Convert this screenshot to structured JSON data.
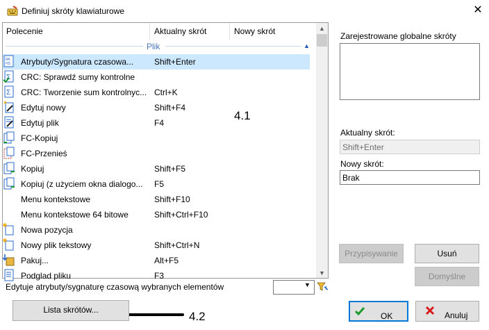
{
  "window": {
    "title": "Definiuj skróty klawiaturowe",
    "close_glyph": "✕"
  },
  "list": {
    "columns": [
      "Polecenie",
      "Aktualny skrót",
      "Nowy skrót"
    ],
    "group": "Plik",
    "rows": [
      {
        "name": "Atrybuty/Sygnatura czasowa...",
        "shortcut": "Shift+Enter",
        "icon": "attributes-icon",
        "selected": true
      },
      {
        "name": "CRC: Sprawdź sumy kontrolne",
        "shortcut": "",
        "icon": "checksum-verify-icon"
      },
      {
        "name": "CRC: Tworzenie sum kontrolnyc...",
        "shortcut": "Ctrl+K",
        "icon": "checksum-create-icon"
      },
      {
        "name": "Edytuj nowy",
        "shortcut": "Shift+F4",
        "icon": "edit-new-icon"
      },
      {
        "name": "Edytuj plik",
        "shortcut": "F4",
        "icon": "edit-file-icon"
      },
      {
        "name": "FC-Kopiuj",
        "shortcut": "",
        "icon": "fc-copy-icon"
      },
      {
        "name": "FC-Przenieś",
        "shortcut": "",
        "icon": "fc-move-icon"
      },
      {
        "name": "Kopiuj",
        "shortcut": "Shift+F5",
        "icon": "copy-icon"
      },
      {
        "name": "Kopiuj (z użyciem okna dialogo...",
        "shortcut": "F5",
        "icon": "copy-dialog-icon"
      },
      {
        "name": "Menu kontekstowe",
        "shortcut": "Shift+F10",
        "icon": ""
      },
      {
        "name": "Menu kontekstowe 64 bitowe",
        "shortcut": "Shift+Ctrl+F10",
        "icon": ""
      },
      {
        "name": "Nowa pozycja",
        "shortcut": "",
        "icon": "new-item-icon"
      },
      {
        "name": "Nowy plik tekstowy",
        "shortcut": "Shift+Ctrl+N",
        "icon": "new-text-file-icon"
      },
      {
        "name": "Pakuj...",
        "shortcut": "Alt+F5",
        "icon": "pack-icon"
      },
      {
        "name": "Podglad pliku",
        "shortcut": "F3",
        "icon": "view-file-icon"
      }
    ]
  },
  "annotations": {
    "a1": "4.1",
    "a2": "4.2"
  },
  "panel": {
    "globals_label": "Zarejestrowane globalne skróty",
    "current_label": "Aktualny skrót:",
    "current_value": "Shift+Enter",
    "new_label": "Nowy skrót:",
    "new_value": "Brak",
    "assign_button": "Przypisywanie",
    "remove_button": "Usuń",
    "default_button": "Domyślne"
  },
  "status": {
    "text": "Edytuje atrybuty/sygnaturę czasową wybranych elementów",
    "combo_value": ""
  },
  "buttons": {
    "list": "Lista skrótów...",
    "ok": "OK",
    "cancel": "Anuluj"
  },
  "colors": {
    "selection": "#cce8ff",
    "accent": "#0078d7",
    "group": "#4a74b8"
  }
}
